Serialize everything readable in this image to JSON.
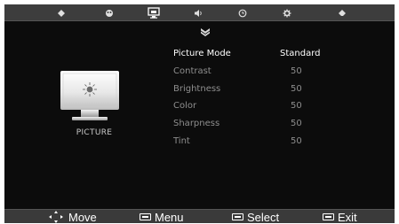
{
  "tabs": [
    {
      "icon": "channel-icon",
      "active": false
    },
    {
      "icon": "palette-icon",
      "active": false
    },
    {
      "icon": "picture-monitor-icon",
      "active": true
    },
    {
      "icon": "speaker-icon",
      "active": false
    },
    {
      "icon": "clock-icon",
      "active": false
    },
    {
      "icon": "gear-icon",
      "active": false
    },
    {
      "icon": "lock-icon",
      "active": false
    }
  ],
  "section": {
    "label": "PICTURE",
    "icon": "picture-monitor-sun-icon"
  },
  "settings": [
    {
      "name": "Picture Mode",
      "value": "Standard",
      "selected": true
    },
    {
      "name": "Contrast",
      "value": "50",
      "selected": false
    },
    {
      "name": "Brightness",
      "value": "50",
      "selected": false
    },
    {
      "name": "Color",
      "value": "50",
      "selected": false
    },
    {
      "name": "Sharpness",
      "value": "50",
      "selected": false
    },
    {
      "name": "Tint",
      "value": "50",
      "selected": false
    }
  ],
  "hints": {
    "move": "Move",
    "menu": "Menu",
    "select": "Select",
    "exit": "Exit"
  },
  "colors": {
    "background": "#0c0c0c",
    "bar": "#3d3d3d",
    "selected_text": "#ffffff",
    "dim_text": "#8e8e8e"
  }
}
